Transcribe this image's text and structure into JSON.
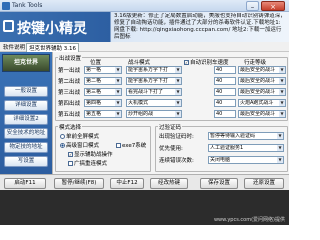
{
  "window": {
    "title": "Tank Tools"
  },
  "banner": {
    "logo_text": "按键小精灵",
    "notice": "3.16版更新：修正了定局数置启动能，美服也支持自动识别铸弹道深，修复了自动掏话功能，插件通过了大部分的杀毒软件认证.下载地址1:网盘下载: http://qingxiaohong.cccpan.com/ 地址2:下载一加运行后图标"
  },
  "menu": {
    "items": [
      "软件说明",
      "坦克世界辅助 3.16"
    ]
  },
  "sidebar": {
    "game_title": "坦克世界",
    "buttons": [
      "一般设置",
      "详细设置",
      "详细设置2",
      "安全技术的地址",
      "物定技的地址",
      "写设置"
    ]
  },
  "moves": {
    "title": "出战设置",
    "headers": {
      "position": "位置",
      "tank": "战斗模式",
      "level": "行走等级"
    },
    "rows": [
      {
        "label": "第一出战",
        "position": "第一格",
        "tank": "能宇宙系方字下打",
        "speed": "40",
        "level": "最后安全的战斗"
      },
      {
        "label": "第二出战",
        "position": "第二格",
        "tank": "能宇宙系方字下打",
        "speed": "40",
        "level": "最后安全的战斗"
      },
      {
        "label": "第三出战",
        "position": "第三格",
        "tank": "看完战斗下打了",
        "speed": "40",
        "level": "最后安全的战斗"
      },
      {
        "label": "第四出战",
        "position": "第四格",
        "tank": "灭机模式",
        "speed": "40",
        "level": "火炮A跑式战斗"
      },
      {
        "label": "第五出战",
        "position": "第五格",
        "tank": "炒开组的战",
        "speed": "40",
        "level": "最后安全的战斗"
      }
    ],
    "auto_detect": "自动识别车速度"
  },
  "mode": {
    "title": "模式选择",
    "options": [
      "单前全屏模式",
      "高级窗口模式"
    ],
    "exe": "exe7系统",
    "extras": [
      "显示辅助战操作",
      "广搞重连模式"
    ]
  },
  "verify": {
    "title": "过验证码",
    "fields": [
      {
        "label": "出现验证码时:",
        "value": "暂停等待输入验证码"
      },
      {
        "label": "优先使用:",
        "value": "人工验证服务1"
      },
      {
        "label": "连续错误次数:",
        "value": "关闭电脑"
      }
    ]
  },
  "bottom": {
    "buttons": [
      "启动F11",
      "暂停/继续(F8)",
      "中止F12",
      "经改热键",
      "保存设置",
      "还原设置"
    ]
  },
  "status": {
    "text": "www.ypcs.com(爱问网络)提供"
  }
}
